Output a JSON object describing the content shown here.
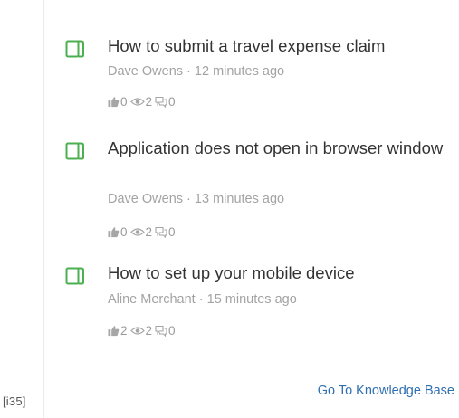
{
  "corner_label": "[i35]",
  "articles": [
    {
      "title": "How to submit a travel expense claim",
      "author": "Dave Owens",
      "age": "12 minutes ago",
      "likes": "0",
      "views": "2",
      "comments": "0"
    },
    {
      "title": "Application does not open in browser window",
      "author": "Dave Owens",
      "age": "13 minutes ago",
      "likes": "0",
      "views": "2",
      "comments": "0"
    },
    {
      "title": "How to set up your mobile device",
      "author": "Aline Merchant",
      "age": "15 minutes ago",
      "likes": "2",
      "views": "2",
      "comments": "0"
    }
  ],
  "separator": "·",
  "kb_link": "Go To Knowledge Base",
  "icons": {
    "article": "book-icon",
    "likes": "thumbs-up-icon",
    "views": "eye-icon",
    "comments": "comment-icon"
  },
  "colors": {
    "book": "#4caf50",
    "link": "#2f6fb0",
    "title": "#333333",
    "meta": "#a3a3a3"
  }
}
